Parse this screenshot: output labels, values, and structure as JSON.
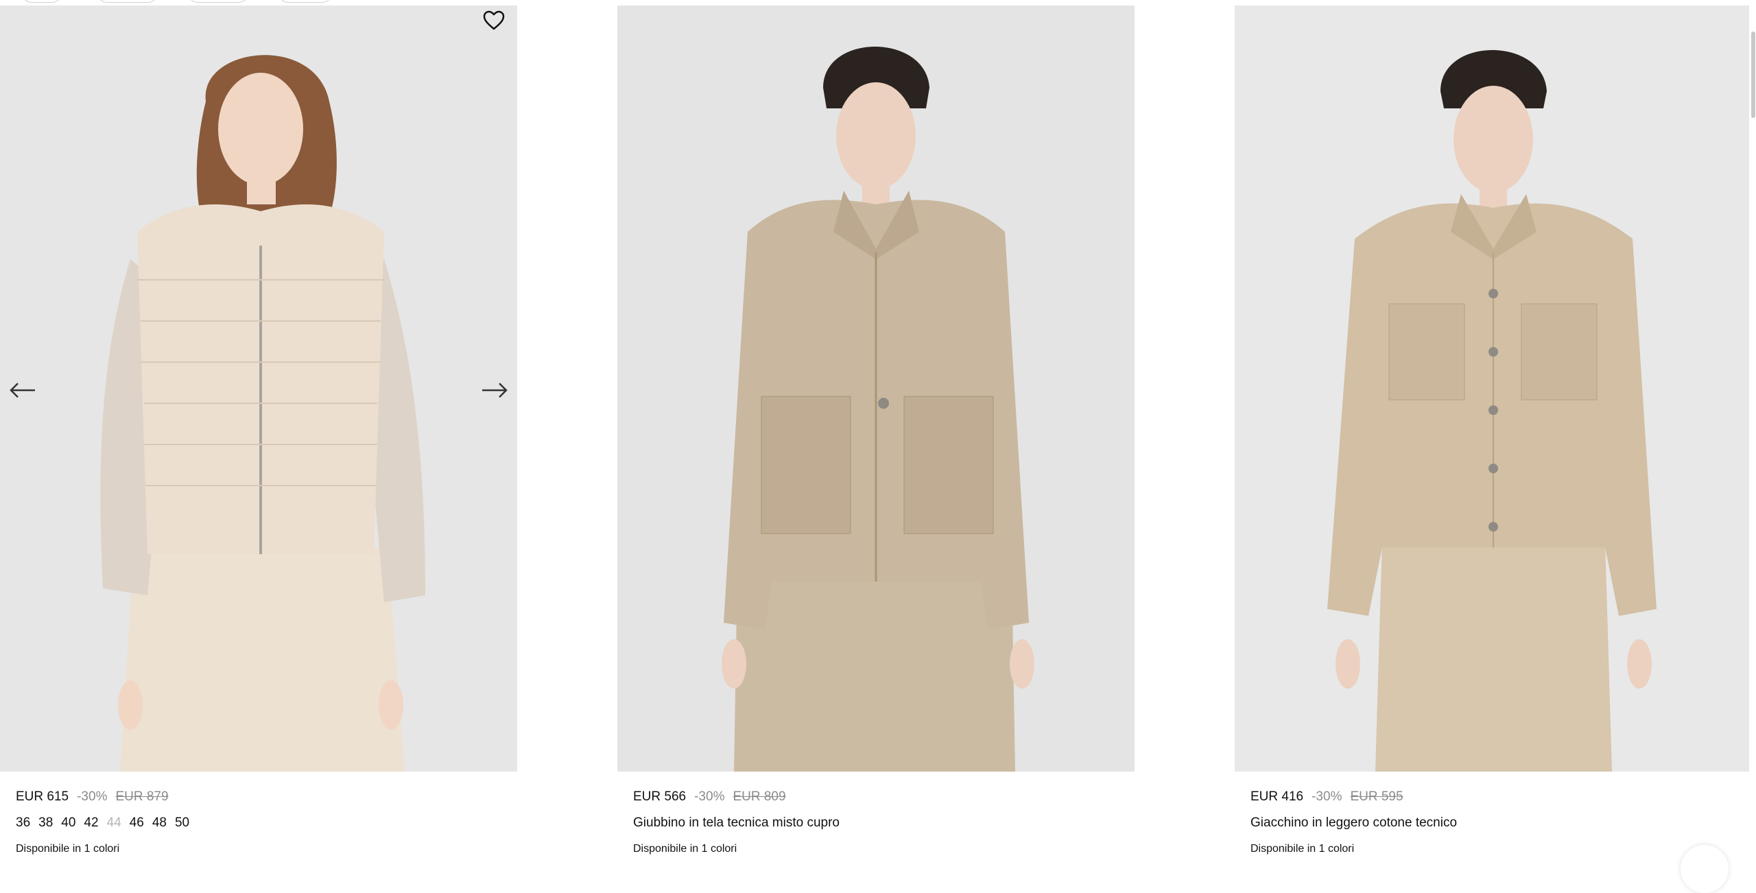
{
  "products": [
    {
      "price": "EUR 615",
      "discount": "-30%",
      "original_price": "EUR 879",
      "sizes": [
        {
          "label": "36",
          "available": true
        },
        {
          "label": "38",
          "available": true
        },
        {
          "label": "40",
          "available": true
        },
        {
          "label": "42",
          "available": true
        },
        {
          "label": "44",
          "available": false
        },
        {
          "label": "46",
          "available": true
        },
        {
          "label": "48",
          "available": true
        },
        {
          "label": "50",
          "available": true
        }
      ],
      "name": "",
      "availability": "Disponibile in 1 colori",
      "garment_color": "#e8d9c8"
    },
    {
      "price": "EUR 566",
      "discount": "-30%",
      "original_price": "EUR 809",
      "sizes": [],
      "name": "Giubbino in tela tecnica misto cupro",
      "availability": "Disponibile in 1 colori",
      "garment_color": "#c9b79f"
    },
    {
      "price": "EUR 416",
      "discount": "-30%",
      "original_price": "EUR 595",
      "sizes": [],
      "name": "Giacchino in leggero cotone tecnico",
      "availability": "Disponibile in 1 colori",
      "garment_color": "#d2bfa4"
    }
  ],
  "icons": {
    "wishlist": "heart-outline-icon",
    "prev": "arrow-left-icon",
    "next": "arrow-right-icon"
  },
  "colors": {
    "text": "#111111",
    "muted": "#8b8b8b",
    "unavailable": "#b5b5b5",
    "image_bg": "#e8e8e8"
  }
}
